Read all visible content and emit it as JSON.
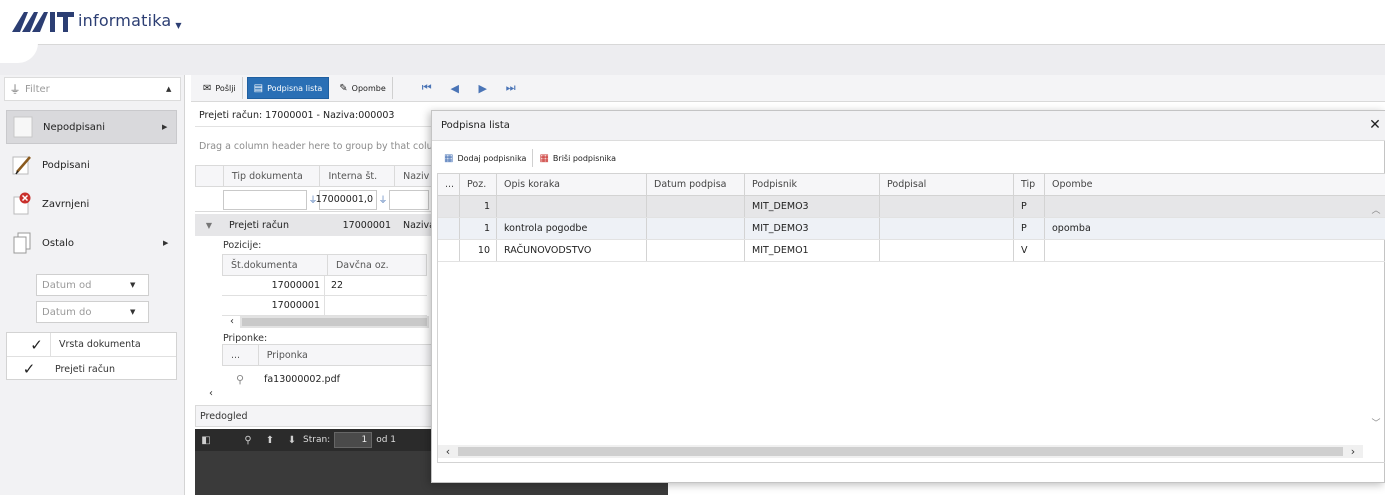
{
  "app": {
    "brand": "informatika"
  },
  "left": {
    "filter_placeholder": "Filter",
    "nav": [
      {
        "label": "Nepodpisani"
      },
      {
        "label": "Podpisani"
      },
      {
        "label": "Zavrnjeni"
      },
      {
        "label": "Ostalo"
      }
    ],
    "date_from": "Datum od",
    "date_to": "Datum do",
    "doc_type_header": "Vrsta dokumenta",
    "doc_type_value": "Prejeti račun"
  },
  "toolbar": {
    "send": "Pošlji",
    "signature_list": "Podpisna lista",
    "notes": "Opombe"
  },
  "doc": {
    "title": "Prejeti račun: 17000001 - Naziva:000003",
    "group_hint": "Drag a column header here to group by that column",
    "col_type": "Tip dokumenta",
    "col_internal": "Interna št.",
    "col_name": "Naziv",
    "filter_internal": "17000001,0",
    "row_type": "Prejeti račun",
    "row_internal": "17000001",
    "row_name": "Naziva",
    "positions_label": "Pozicije:",
    "pos_col_doc": "Št.dokumenta",
    "pos_col_tax": "Davčna oz.",
    "pos_rows": [
      {
        "doc": "17000001",
        "tax": "22"
      },
      {
        "doc": "17000001",
        "tax": ""
      }
    ],
    "attachments_label": "Priponke:",
    "att_col_dots": "...",
    "att_col_name": "Priponka",
    "att_file": "fa13000002.pdf",
    "preview": "Predogled",
    "pdf_page_label": "Stran:",
    "pdf_page": "1",
    "pdf_of": "od 1"
  },
  "modal": {
    "title": "Podpisna lista",
    "add_signer": "Dodaj podpisnika",
    "delete_signer": "Briši podpisnika",
    "columns": [
      "...",
      "Poz.",
      "Opis koraka",
      "Datum podpisa",
      "Podpisnik",
      "Podpisal",
      "Tip",
      "Opombe"
    ],
    "rows": [
      {
        "poz": "1",
        "opis": "",
        "datum": "",
        "podpisnik": "MIT_DEMO3",
        "podpisal": "",
        "tip": "P",
        "opombe": ""
      },
      {
        "poz": "1",
        "opis": "kontrola pogodbe",
        "datum": "",
        "podpisnik": "MIT_DEMO3",
        "podpisal": "",
        "tip": "P",
        "opombe": "opomba"
      },
      {
        "poz": "10",
        "opis": "RAČUNOVODSTVO",
        "datum": "",
        "podpisnik": "MIT_DEMO1",
        "podpisal": "",
        "tip": "V",
        "opombe": ""
      }
    ]
  },
  "colors": {
    "brand": "#2c3e73",
    "primary": "#2a6fb5",
    "accent_icon": "#4a74b6"
  }
}
